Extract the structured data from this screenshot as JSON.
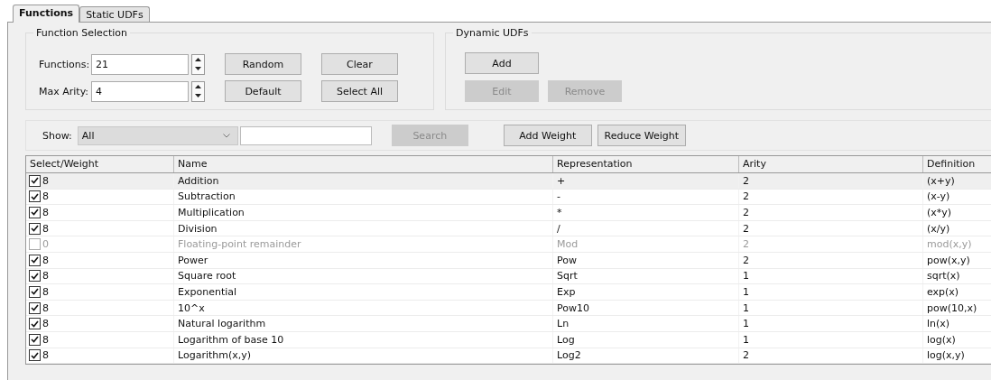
{
  "tabs": [
    {
      "label": "Functions",
      "selected": true
    },
    {
      "label": "Static UDFs",
      "selected": false
    }
  ],
  "function_selection": {
    "title": "Function Selection",
    "fields": [
      {
        "label": "Functions:",
        "value": "21"
      },
      {
        "label": "Max Arity:",
        "value": "4"
      }
    ],
    "buttons": [
      {
        "label": "Random",
        "disabled": false
      },
      {
        "label": "Clear",
        "disabled": false
      },
      {
        "label": "Default",
        "disabled": false
      },
      {
        "label": "Select All",
        "disabled": false
      }
    ]
  },
  "dynamic_udfs": {
    "title": "Dynamic UDFs",
    "buttons": [
      {
        "label": "Add",
        "disabled": false
      },
      {
        "label": "Edit",
        "disabled": true
      },
      {
        "label": "Remove",
        "disabled": true
      }
    ]
  },
  "filter": {
    "label": "Show:",
    "dropdown": "All",
    "search_button": {
      "label": "Search",
      "disabled": true
    },
    "buttons": [
      {
        "label": "Add Weight",
        "disabled": false
      },
      {
        "label": "Reduce Weight",
        "disabled": false
      }
    ]
  },
  "table": {
    "columns": [
      "Select/Weight",
      "Name",
      "Representation",
      "Arity",
      "Definition"
    ],
    "rows": [
      {
        "checked": true,
        "selected": true,
        "weight": "8",
        "name": "Addition",
        "representation": "+",
        "arity": "2",
        "definition": "(x+y)"
      },
      {
        "checked": true,
        "selected": false,
        "weight": "8",
        "name": "Subtraction",
        "representation": "-",
        "arity": "2",
        "definition": "(x-y)"
      },
      {
        "checked": true,
        "selected": false,
        "weight": "8",
        "name": "Multiplication",
        "representation": "*",
        "arity": "2",
        "definition": "(x*y)"
      },
      {
        "checked": true,
        "selected": false,
        "weight": "8",
        "name": "Division",
        "representation": "/",
        "arity": "2",
        "definition": "(x/y)"
      },
      {
        "checked": false,
        "selected": false,
        "weight": "0",
        "name": "Floating-point remainder",
        "representation": "Mod",
        "arity": "2",
        "definition": "mod(x,y)"
      },
      {
        "checked": true,
        "selected": false,
        "weight": "8",
        "name": "Power",
        "representation": "Pow",
        "arity": "2",
        "definition": "pow(x,y)"
      },
      {
        "checked": true,
        "selected": false,
        "weight": "8",
        "name": "Square root",
        "representation": "Sqrt",
        "arity": "1",
        "definition": "sqrt(x)"
      },
      {
        "checked": true,
        "selected": false,
        "weight": "8",
        "name": "Exponential",
        "representation": "Exp",
        "arity": "1",
        "definition": "exp(x)"
      },
      {
        "checked": true,
        "selected": false,
        "weight": "8",
        "name": "10^x",
        "representation": "Pow10",
        "arity": "1",
        "definition": "pow(10,x)"
      },
      {
        "checked": true,
        "selected": false,
        "weight": "8",
        "name": "Natural logarithm",
        "representation": "Ln",
        "arity": "1",
        "definition": "ln(x)"
      },
      {
        "checked": true,
        "selected": false,
        "weight": "8",
        "name": "Logarithm of base 10",
        "representation": "Log",
        "arity": "1",
        "definition": "log(x)"
      },
      {
        "checked": true,
        "selected": false,
        "weight": "8",
        "name": "Logarithm(x,y)",
        "representation": "Log2",
        "arity": "2",
        "definition": "log(x,y)"
      }
    ]
  }
}
